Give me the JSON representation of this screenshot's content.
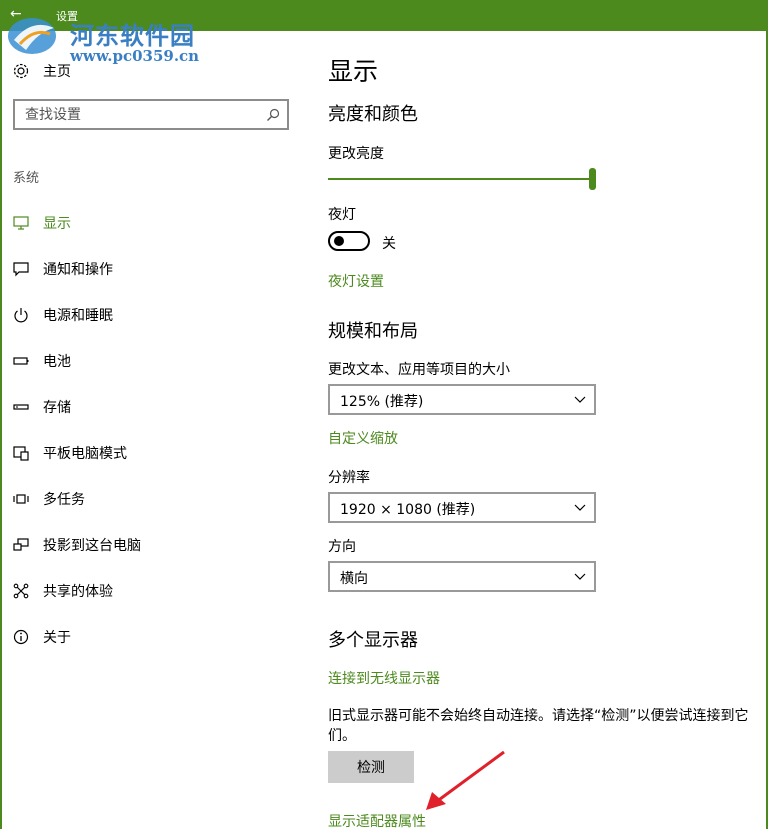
{
  "window": {
    "title": "设置",
    "back_glyph": "←"
  },
  "watermark": {
    "name": "河东软件园",
    "url": "www.pc0359.cn"
  },
  "sidebar": {
    "home_label": "主页",
    "search_placeholder": "查找设置",
    "section_label": "系统",
    "items": [
      {
        "label": "显示",
        "icon": "monitor-icon",
        "active": true
      },
      {
        "label": "通知和操作",
        "icon": "message-icon",
        "active": false
      },
      {
        "label": "电源和睡眠",
        "icon": "power-icon",
        "active": false
      },
      {
        "label": "电池",
        "icon": "battery-icon",
        "active": false
      },
      {
        "label": "存储",
        "icon": "storage-icon",
        "active": false
      },
      {
        "label": "平板电脑模式",
        "icon": "tablet-icon",
        "active": false
      },
      {
        "label": "多任务",
        "icon": "multitask-icon",
        "active": false
      },
      {
        "label": "投影到这台电脑",
        "icon": "project-icon",
        "active": false
      },
      {
        "label": "共享的体验",
        "icon": "share-icon",
        "active": false
      },
      {
        "label": "关于",
        "icon": "info-icon",
        "active": false
      }
    ]
  },
  "main": {
    "page_title": "显示",
    "brightness_section": "亮度和颜色",
    "brightness_label": "更改亮度",
    "brightness_value": 1.0,
    "night_light_label": "夜灯",
    "night_light_state": "关",
    "night_light_settings_link": "夜灯设置",
    "scale_section": "规模和布局",
    "scale_label": "更改文本、应用等项目的大小",
    "scale_value": "125% (推荐)",
    "custom_scale_link": "自定义缩放",
    "resolution_label": "分辨率",
    "resolution_value": "1920 × 1080 (推荐)",
    "orientation_label": "方向",
    "orientation_value": "横向",
    "multi_display_section": "多个显示器",
    "wireless_link": "连接到无线显示器",
    "description": "旧式显示器可能不会始终自动连接。请选择“检测”以便尝试连接到它们。",
    "detect_button": "检测",
    "adapter_link": "显示适配器属性"
  },
  "colors": {
    "accent": "#4c8a1e",
    "annotation_arrow": "#e0202a"
  }
}
